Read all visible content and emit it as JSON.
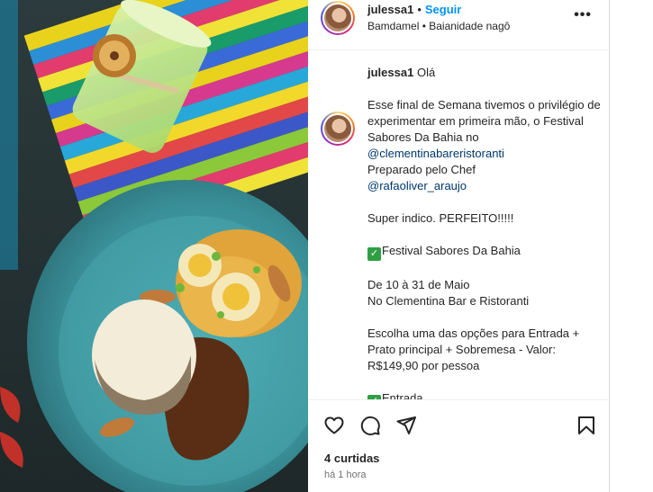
{
  "post": {
    "username": "julessa1",
    "separator": "•",
    "follow_label": "Seguir",
    "subtitle": "Bamdamel • Baianidade nagô",
    "more_label": "•••"
  },
  "caption": {
    "username": "julessa1",
    "greeting": "Olá",
    "p1_prefix": "Esse final de Semana tivemos o privilégio de experimentar em primeira mão, o Festival Sabores Da Bahia no",
    "mention_restaurant": "@clementinabareristoranti",
    "p1_mid": "Preparado pelo Chef",
    "mention_chef": "@rafaoliver_araujo",
    "p2": "Super indico. PERFEITO!!!!!",
    "p3": "Festival Sabores Da Bahia",
    "p4_line1": "De 10 à 31 de Maio",
    "p4_line2": "No Clementina Bar e Ristoranti",
    "p5": "Escolha uma das opções para Entrada + Prato principal + Sobremesa - Valor: R$149,90 por pessoa",
    "p6": "Entrada",
    "check_glyph": "✓"
  },
  "actions": {
    "like_icon": "heart-icon",
    "comment_icon": "comment-icon",
    "share_icon": "send-icon",
    "save_icon": "bookmark-icon"
  },
  "footer": {
    "likes": "4 curtidas",
    "time": "há 1 hora"
  },
  "colors": {
    "follow": "#0095f6",
    "mention": "#00376b",
    "check": "#2ea043",
    "plate": "#3f9aa3"
  }
}
